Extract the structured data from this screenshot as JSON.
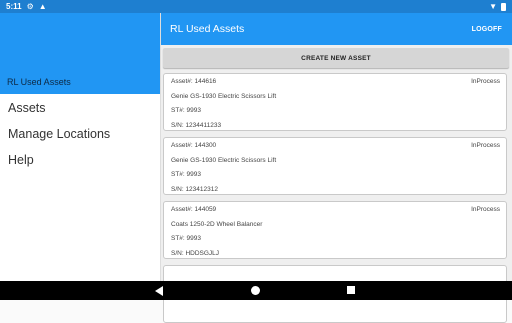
{
  "status_bar": {
    "time": "5:11",
    "icons": [
      "gear-icon",
      "shield-icon",
      "wifi-icon",
      "battery-icon"
    ]
  },
  "drawer": {
    "header_title": "RL Used Assets",
    "items": [
      {
        "label": "Assets"
      },
      {
        "label": "Manage Locations"
      },
      {
        "label": "Help"
      }
    ]
  },
  "app_bar": {
    "title": "RL Used Assets",
    "logoff_label": "LOGOFF"
  },
  "create_button_label": "CREATE NEW ASSET",
  "assets": [
    {
      "asset_no": "Asset#: 144616",
      "status": "InProcess",
      "description": "Genie GS-1930 Electric Scissors Lift",
      "st": "ST#: 9993",
      "sn": "S/N: 1234411233"
    },
    {
      "asset_no": "Asset#: 144300",
      "status": "InProcess",
      "description": "Genie GS-1930 Electric Scissors Lift",
      "st": "ST#: 9993",
      "sn": "S/N: 123412312"
    },
    {
      "asset_no": "Asset#: 144059",
      "status": "InProcess",
      "description": "Coats 1250-2D  Wheel Balancer",
      "st": "ST#: 9993",
      "sn": "S/N: HDDSGJLJ"
    }
  ],
  "colors": {
    "primary": "#2196f3",
    "status_bar": "#1e7fd0",
    "button": "#d6d6d6"
  }
}
